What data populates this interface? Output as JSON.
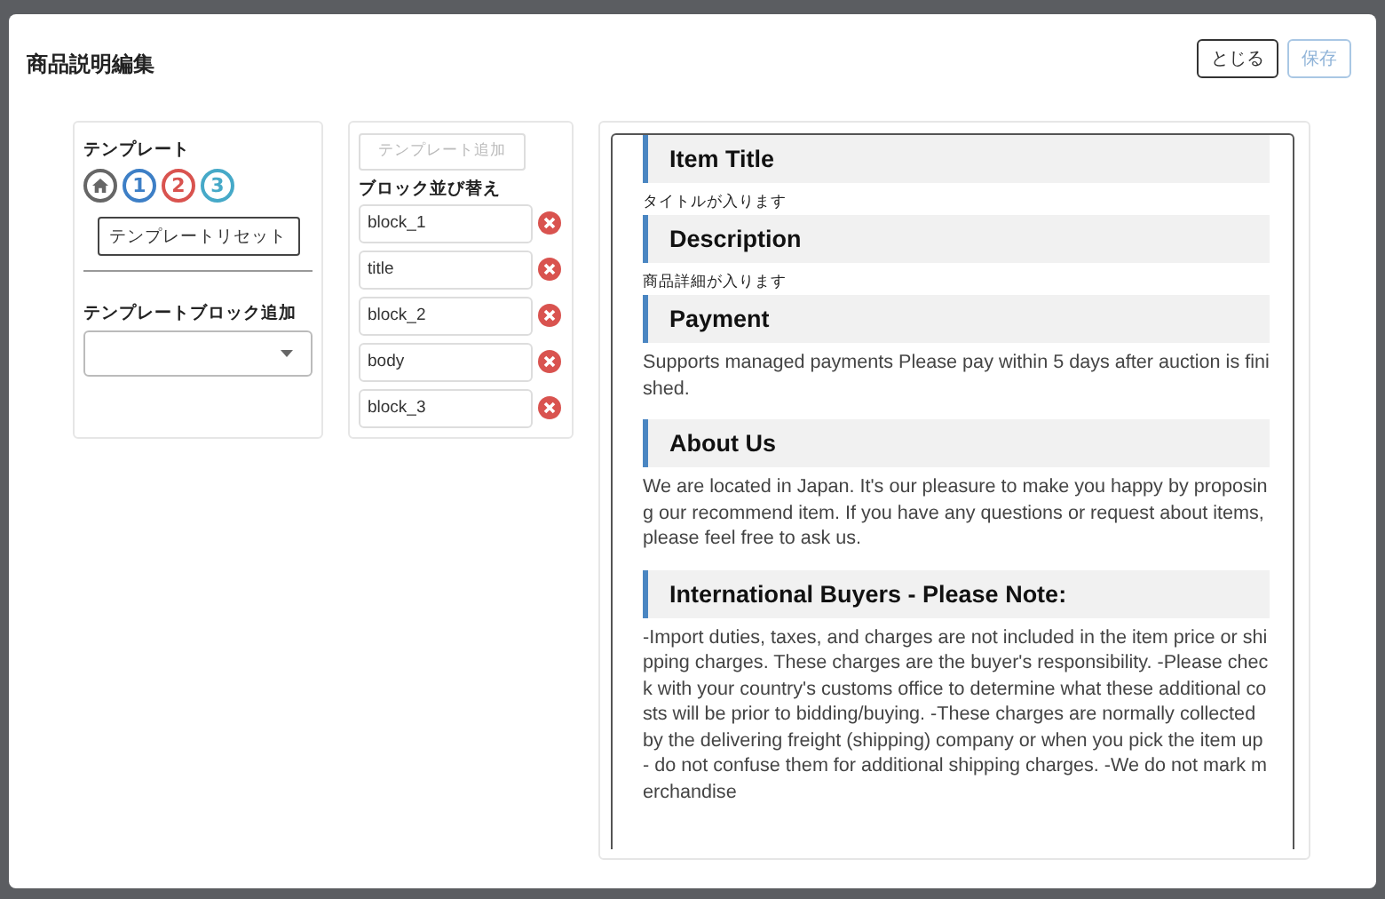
{
  "dialog": {
    "title": "商品説明編集",
    "buttons": [
      {
        "label": "とじる",
        "disabled": false
      },
      {
        "label": "保存",
        "disabled": true
      }
    ]
  },
  "template_panel": {
    "heading": "テンプレート",
    "templates": [
      {
        "kind": "home",
        "color": "#666666"
      },
      {
        "kind": "number",
        "label": "1",
        "color": "#3d7fc6"
      },
      {
        "kind": "number",
        "label": "2",
        "color": "#d9534f"
      },
      {
        "kind": "number",
        "label": "3",
        "color": "#46a9c8"
      }
    ],
    "reset_button": "テンプレートリセット",
    "block_add_label": "テンプレートブロック追加"
  },
  "block_panel": {
    "add_button": {
      "label": "テンプレート追加",
      "disabled": true
    },
    "heading": "ブロック並び替え",
    "blocks": [
      {
        "name": "block_1"
      },
      {
        "name": "title"
      },
      {
        "name": "block_2"
      },
      {
        "name": "body"
      },
      {
        "name": "block_3"
      }
    ]
  },
  "preview": [
    {
      "heading": "Item Title",
      "text": "タイトルが入ります",
      "kind": "small"
    },
    {
      "heading": "Description",
      "text": "商品詳細が入ります",
      "kind": "small"
    },
    {
      "heading": "Payment",
      "text": "Supports managed payments Please pay within 5 days after auction is finished.",
      "kind": "body"
    },
    {
      "heading": "About Us",
      "text": "We are located in Japan. It's our pleasure to make you happy by proposing our recommend item. If you have any questions or request about items, please feel free to ask us.",
      "kind": "body"
    },
    {
      "heading": "International Buyers - Please Note:",
      "text": "-Import duties, taxes, and charges are not included in the item price or shipping charges. These charges are the buyer's responsibility. -Please check with your country's customs office to determine what these additional costs will be prior to bidding/buying. -These charges are normally collected by the delivering freight (shipping) company or when you pick the item up - do not confuse them for additional shipping charges. -We do not mark merchandise",
      "kind": "body"
    }
  ]
}
